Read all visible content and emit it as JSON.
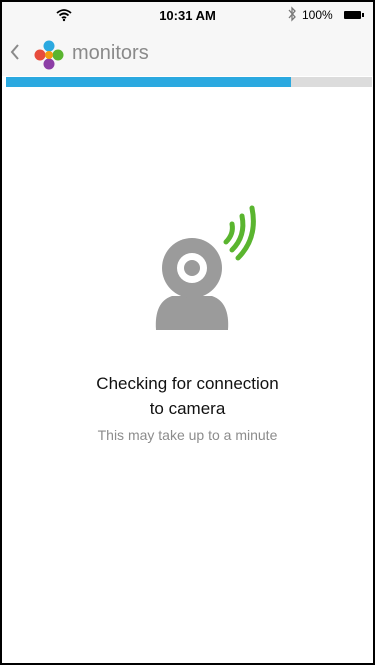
{
  "status_bar": {
    "time": "10:31 AM",
    "battery": "100%",
    "icons": [
      "wifi-icon",
      "bluetooth-icon",
      "battery-icon"
    ]
  },
  "nav": {
    "back_icon": "chevron-left-icon",
    "logo_icon": "app-logo-icon",
    "title": "monitors"
  },
  "progress": {
    "fraction": 0.78,
    "color": "#2ba9e0"
  },
  "content": {
    "illustration_icon": "baby-monitor-camera-icon",
    "headline_line1": "Checking for connection",
    "headline_line2": "to camera",
    "subtext": "This may take up to a minute"
  },
  "colors": {
    "accent": "#2ba9e0",
    "signal": "#5ab52f",
    "camera": "#9b9b9b"
  }
}
